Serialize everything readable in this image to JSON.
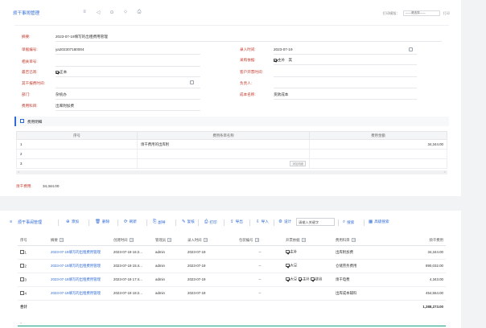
{
  "header": {
    "title": "烦干事闹管理",
    "icons": [
      "≡",
      "◁",
      "⊙",
      "⬦",
      "⎙"
    ],
    "print_label": "打印模版：",
    "print_select": "——请选择——",
    "print_button": "打印"
  },
  "form": {
    "topic_label": "摘要:",
    "topic_value": "2023-07-19填写的出租费用管理",
    "doc_no_label": "单据编号:",
    "doc_no_value": "ya202307180004",
    "entry_date_label": "录入时间:",
    "entry_date_value": "2023-07-19",
    "related_label": "相关单号:",
    "related_value": "",
    "invoice_flag_label": "采购依据:",
    "invoice_flag_opt1": "主补",
    "invoice_flag_opt2": "其",
    "need_invoice_label": "最否已寄:",
    "need_invoice_opt": "正本",
    "related_doc_label": "客户开票时间:",
    "related_doc_value": "",
    "expense_date_label": "其干报费时间:",
    "expense_date_value": "",
    "payee_label": "负责人:",
    "payee_value": "",
    "dept_label": "部门:",
    "dept_value": "杂统办",
    "cost_label": "成本名称:",
    "cost_value": "货款成本",
    "type_label": "费用科目:",
    "type_value": "出库附加费"
  },
  "detail": {
    "title": "费用明细",
    "columns": [
      "序号",
      "费用条目名称",
      "费用金额"
    ],
    "rows": [
      {
        "no": "1",
        "name": "烦干费用的出库附",
        "amount": "34,344.00"
      },
      {
        "no": "2",
        "name": "",
        "amount": ""
      },
      {
        "no": "3",
        "name": "",
        "amount": ""
      }
    ],
    "add_tag": "添加明细",
    "sum_label": "烦干费用:",
    "sum_value": "34,344.00"
  },
  "toolbar": {
    "title": "烦干事闹管理",
    "items": [
      "添加",
      "删除",
      "刷新",
      "副导",
      "复核",
      "打印",
      "导出",
      "导入",
      "设计"
    ],
    "item_icons": [
      "⊕",
      "🗑",
      "⟳",
      "⎘",
      "✎",
      "⎙",
      "⇪",
      "⇩",
      "⚙"
    ],
    "search_placeholder": "请输入关键字",
    "search_button": "搜索",
    "advanced_button": "高级搜索"
  },
  "list": {
    "columns": [
      "序号",
      "摘要",
      "创建时间",
      "管理员",
      "录入时间",
      "包装编号",
      "开票依据",
      "费用科目",
      "烦干费用"
    ],
    "rows": [
      {
        "no": "1",
        "summary": "2023-07-19填写的出租费用管理",
        "created": "2023-07-19 16:2...",
        "admin": "admin",
        "entry": "2023-07-19",
        "pack": "--",
        "basis": [
          "主补"
        ],
        "subject": "出库附加费",
        "amount": "34,344.00"
      },
      {
        "no": "2",
        "summary": "2023-07-19填写的出租费用管理",
        "created": "2023-07-19 15:4...",
        "admin": "admin",
        "entry": "2023-07-19",
        "pack": "--",
        "basis": [
          "大豆"
        ],
        "subject": "仓储劳务费用",
        "amount": "890,032.00"
      },
      {
        "no": "3",
        "summary": "2023-07-19填写的出租费用管理",
        "created": "2023-07-19 17:4...",
        "admin": "admin",
        "entry": "2023-07-19",
        "pack": "--",
        "basis": [
          "大豆",
          "主补",
          "烧谷"
        ],
        "subject": "烦干电费",
        "amount": "4,343.00"
      },
      {
        "no": "4",
        "summary": "2023-07-19填写的出租费用管理",
        "created": "2023-07-19 18:2...",
        "admin": "admin",
        "entry": "2023-07-19",
        "pack": "--",
        "basis": [],
        "subject": "出库成本辅料",
        "amount": "454,554.00"
      }
    ],
    "total_label": "合计",
    "total_value": "1,388,273.00"
  }
}
